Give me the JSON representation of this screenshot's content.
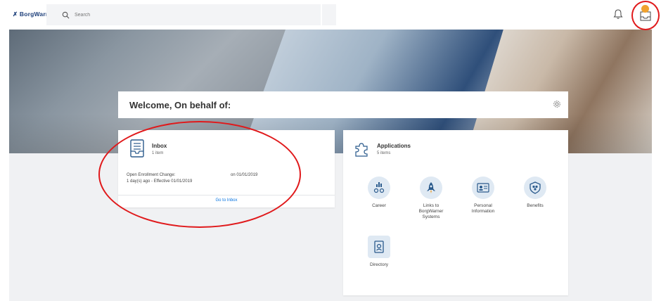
{
  "topbar": {
    "logo_text": "BorgWarner",
    "search_placeholder": "Search",
    "bell_icon": "bell-icon",
    "inbox_icon": "inbox-icon",
    "badge_color": "#f0a22e"
  },
  "welcome": {
    "title": "Welcome, On behalf of:",
    "settings_icon": "gear-icon"
  },
  "inbox": {
    "label": "Inbox",
    "count": "1 item",
    "task_title": "Open Enrollment Change:",
    "task_date": "on 01/01/2019",
    "task_sub": "1 day(s) ago - Effective 01/01/2019",
    "link": "Go to Inbox"
  },
  "applications": {
    "label": "Applications",
    "count": "5 items",
    "apps": [
      {
        "name": "Career",
        "icon": "career-icon"
      },
      {
        "name": "Links to BorgWarner Systems",
        "icon": "rocket-icon"
      },
      {
        "name": "Personal Information",
        "icon": "id-card-icon"
      },
      {
        "name": "Benefits",
        "icon": "shield-icon"
      },
      {
        "name": "Directory",
        "icon": "directory-icon"
      }
    ]
  },
  "colors": {
    "accent": "#0875e1",
    "annotation": "#e0191b",
    "app_icon_bg": "#dfe9f3",
    "app_icon_fg": "#2a5a8c"
  }
}
